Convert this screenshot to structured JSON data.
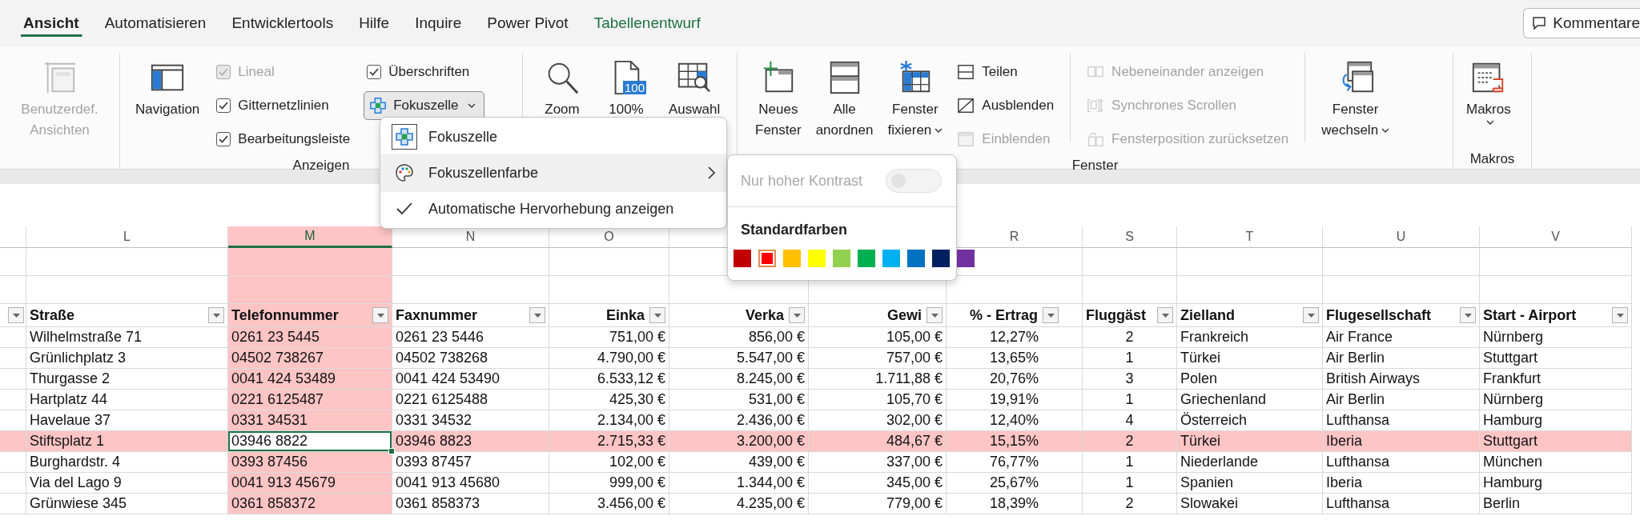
{
  "tabs": [
    {
      "label": "Ansicht",
      "selected": true,
      "kind": "standard"
    },
    {
      "label": "Automatisieren",
      "selected": false,
      "kind": "standard"
    },
    {
      "label": "Entwicklertools",
      "selected": false,
      "kind": "standard"
    },
    {
      "label": "Hilfe",
      "selected": false,
      "kind": "standard"
    },
    {
      "label": "Inquire",
      "selected": false,
      "kind": "standard"
    },
    {
      "label": "Power Pivot",
      "selected": false,
      "kind": "standard"
    },
    {
      "label": "Tabellenentwurf",
      "selected": false,
      "kind": "contextual"
    }
  ],
  "comments_button": {
    "label": "Kommentare"
  },
  "ribbon": {
    "groups": [
      {
        "columns": [
          {
            "kind": "large",
            "lines": [
              "Benutzerdef.",
              "Ansichten"
            ],
            "disabled": true,
            "dropdown": false
          }
        ]
      },
      {
        "label": "Anzeigen",
        "columns": [
          {
            "kind": "large",
            "lines": [
              "Navigation"
            ],
            "disabled": false,
            "dropdown": false
          },
          {
            "kind": "checks",
            "items": [
              {
                "label": "Lineal",
                "checked": true,
                "disabled": true
              },
              {
                "label": "Gitternetzlinien",
                "checked": true,
                "disabled": false
              },
              {
                "label": "Bearbeitungsleiste",
                "checked": true,
                "disabled": false
              }
            ]
          },
          {
            "kind": "checks",
            "items": [
              {
                "label": "Überschriften",
                "checked": true,
                "disabled": false
              }
            ],
            "split_button": {
              "label": "Fokuszelle",
              "expanded": true
            }
          }
        ]
      },
      {
        "columns": [
          {
            "kind": "large",
            "lines": [
              "Zoom"
            ],
            "disabled": false,
            "dropdown": false
          },
          {
            "kind": "large",
            "lines": [
              "100%"
            ],
            "badge": "100",
            "disabled": false,
            "dropdown": false
          },
          {
            "kind": "large",
            "lines": [
              "Auswahl"
            ],
            "disabled": false,
            "dropdown": false
          }
        ]
      },
      {
        "label": "Fenster",
        "columns": [
          {
            "kind": "large",
            "lines": [
              "Neues",
              "Fenster"
            ],
            "disabled": false,
            "dropdown": false
          },
          {
            "kind": "large",
            "lines": [
              "Alle",
              "anordnen"
            ],
            "disabled": false,
            "dropdown": false
          },
          {
            "kind": "large",
            "lines": [
              "Fenster",
              "fixieren"
            ],
            "disabled": false,
            "dropdown": true
          },
          {
            "kind": "small",
            "items": [
              {
                "label": "Teilen",
                "disabled": false
              },
              {
                "label": "Ausblenden",
                "disabled": false
              },
              {
                "label": "Einblenden",
                "disabled": true
              }
            ]
          },
          {
            "kind": "separator"
          },
          {
            "kind": "small",
            "items": [
              {
                "label": "Nebeneinander anzeigen",
                "disabled": true
              },
              {
                "label": "Synchrones Scrollen",
                "disabled": true
              },
              {
                "label": "Fensterposition zurücksetzen",
                "disabled": true
              }
            ]
          },
          {
            "kind": "separator"
          },
          {
            "kind": "large",
            "lines": [
              "Fenster",
              "wechseln"
            ],
            "disabled": false,
            "dropdown": true
          }
        ]
      },
      {
        "label": "Makros",
        "columns": [
          {
            "kind": "large",
            "lines": [
              "Makros"
            ],
            "disabled": false,
            "dropdown": true
          }
        ]
      }
    ]
  },
  "sheet": {
    "stub_column": {
      "filter": true
    },
    "columns": [
      {
        "letter": "L",
        "header": "Straße",
        "kind": "text",
        "filter": true,
        "selected": false
      },
      {
        "letter": "M",
        "header": "Telefonnummer",
        "kind": "text",
        "filter": true,
        "selected": true
      },
      {
        "letter": "N",
        "header": "Faxnummer",
        "kind": "text",
        "filter": true,
        "selected": false
      },
      {
        "letter": "O",
        "header": "Einka",
        "kind": "money",
        "filter": true,
        "selected": false
      },
      {
        "header": "Verka",
        "kind": "money",
        "filter": true,
        "selected": false
      },
      {
        "header": "Gewi",
        "kind": "money",
        "filter": true,
        "selected": false
      },
      {
        "letter": "R",
        "header": "% - Ertrag",
        "kind": "percent",
        "filter": true,
        "selected": false
      },
      {
        "letter": "S",
        "header": "Fluggäst",
        "kind": "count",
        "filter": true,
        "selected": false
      },
      {
        "letter": "T",
        "header": "Zielland",
        "kind": "text",
        "filter": true,
        "selected": false
      },
      {
        "letter": "U",
        "header": "Flugesellschaft",
        "kind": "text",
        "filter": true,
        "selected": false
      },
      {
        "letter": "V",
        "header": "Start - Airport",
        "kind": "text",
        "filter": true,
        "selected": false
      }
    ],
    "rows": [
      {
        "selected": false,
        "cells": [
          "Wilhelmstraße 71",
          "0261 23 5445",
          "0261 23 5446",
          "751,00 €",
          "856,00 €",
          "105,00 €",
          "12,27%",
          "2",
          "Frankreich",
          "Air France",
          "Nürnberg"
        ]
      },
      {
        "selected": false,
        "cells": [
          "Grünlichplatz 3",
          "04502 738267",
          "04502 738268",
          "4.790,00 €",
          "5.547,00 €",
          "757,00 €",
          "13,65%",
          "1",
          "Türkei",
          "Air Berlin",
          "Stuttgart"
        ]
      },
      {
        "selected": false,
        "cells": [
          "Thurgasse 2",
          "0041 424 53489",
          "0041 424 53490",
          "6.533,12 €",
          "8.245,00 €",
          "1.711,88 €",
          "20,76%",
          "3",
          "Polen",
          "British Airways",
          "Frankfurt"
        ]
      },
      {
        "selected": false,
        "cells": [
          "Hartplatz 44",
          "0221 6125487",
          "0221 6125488",
          "425,30 €",
          "531,00 €",
          "105,70 €",
          "19,91%",
          "1",
          "Griechenland",
          "Air Berlin",
          "Nürnberg"
        ]
      },
      {
        "selected": false,
        "cells": [
          "Havelaue 37",
          "0331 34531",
          "0331 34532",
          "2.134,00 €",
          "2.436,00 €",
          "302,00 €",
          "12,40%",
          "4",
          "Österreich",
          "Lufthansa",
          "Hamburg"
        ]
      },
      {
        "selected": true,
        "cells": [
          "Stiftsplatz 1",
          "03946 8822",
          "03946 8823",
          "2.715,33 €",
          "3.200,00 €",
          "484,67 €",
          "15,15%",
          "2",
          "Türkei",
          "Iberia",
          "Stuttgart"
        ]
      },
      {
        "selected": false,
        "cells": [
          "Burghardstr. 4",
          "0393 87456",
          "0393 87457",
          "102,00 €",
          "439,00 €",
          "337,00 €",
          "76,77%",
          "1",
          "Niederlande",
          "Lufthansa",
          "München"
        ]
      },
      {
        "selected": false,
        "cells": [
          "Via del Lago 9",
          "0041 913 45679",
          "0041 913 45680",
          "999,00 €",
          "1.344,00 €",
          "345,00 €",
          "25,67%",
          "1",
          "Spanien",
          "Iberia",
          "Hamburg"
        ]
      },
      {
        "selected": false,
        "cells": [
          "Grünwiese 345",
          "0361 858372",
          "0361 858373",
          "3.456,00 €",
          "4.235,00 €",
          "779,00 €",
          "18,39%",
          "2",
          "Slowakei",
          "Lufthansa",
          "Berlin"
        ]
      }
    ]
  },
  "focus_menu": {
    "items": [
      {
        "kind": "command",
        "label": "Fokuszelle"
      },
      {
        "kind": "submenu",
        "label": "Fokuszellenfarbe",
        "expanded": true
      },
      {
        "kind": "check",
        "label": "Automatische Hervorhebung anzeigen",
        "checked": true
      }
    ]
  },
  "color_menu": {
    "contrast": {
      "label": "Nur hoher Kontrast",
      "on": false,
      "disabled": true
    },
    "heading": "Standardfarben",
    "swatches": [
      {
        "color": "#c00000",
        "selected": false
      },
      {
        "color": "#ff0000",
        "selected": true
      },
      {
        "color": "#ffc000",
        "selected": false
      },
      {
        "color": "#ffff00",
        "selected": false
      },
      {
        "color": "#92d050",
        "selected": false
      },
      {
        "color": "#00b050",
        "selected": false
      },
      {
        "color": "#00b0f0",
        "selected": false
      },
      {
        "color": "#0070c0",
        "selected": false
      },
      {
        "color": "#002060",
        "selected": false
      },
      {
        "color": "#7030a0",
        "selected": false
      }
    ]
  }
}
